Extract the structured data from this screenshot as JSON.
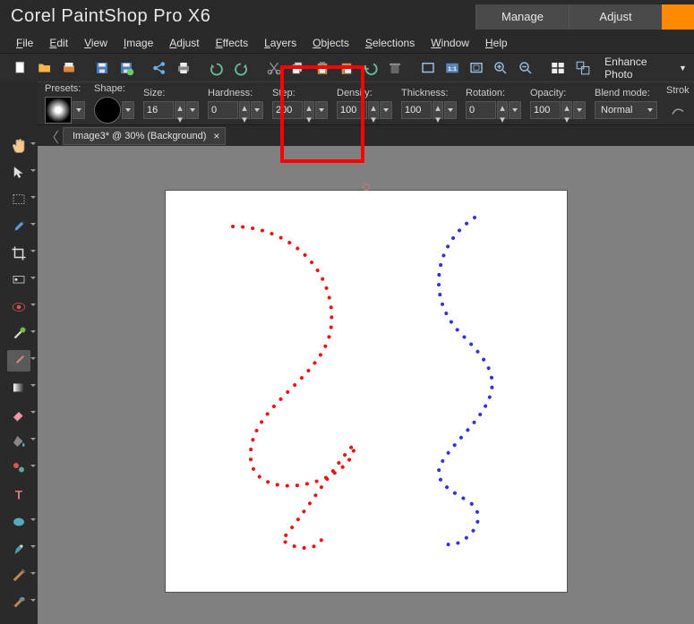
{
  "title": "Corel PaintShop Pro X6",
  "workspace_tabs": {
    "manage": "Manage",
    "adjust": "Adjust"
  },
  "menus": [
    "File",
    "Edit",
    "View",
    "Image",
    "Adjust",
    "Effects",
    "Layers",
    "Objects",
    "Selections",
    "Window",
    "Help"
  ],
  "enhance_label": "Enhance Photo",
  "options": {
    "presets_label": "Presets:",
    "shape_label": "Shape:",
    "size_label": "Size:",
    "size_value": "16",
    "hardness_label": "Hardness:",
    "hardness_value": "0",
    "step_label": "Step:",
    "step_value": "200",
    "density_label": "Density:",
    "density_value": "100",
    "thickness_label": "Thickness:",
    "thickness_value": "100",
    "rotation_label": "Rotation:",
    "rotation_value": "0",
    "opacity_label": "Opacity:",
    "opacity_value": "100",
    "blend_label": "Blend mode:",
    "blend_value": "Normal",
    "stroke_label": "Strok"
  },
  "document_tab": "Image3* @  30% (Background)",
  "red_box": {
    "l": 313,
    "t": 73,
    "w": 94,
    "h": 109
  }
}
